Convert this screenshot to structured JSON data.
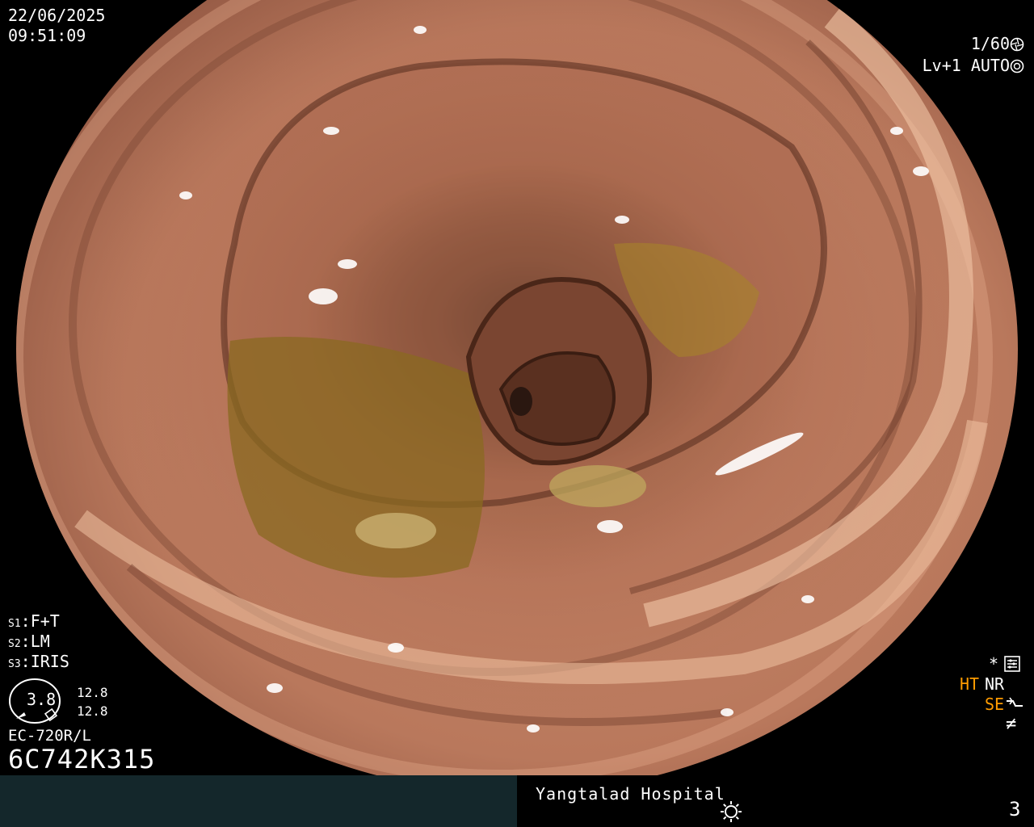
{
  "overlay": {
    "date": "22/06/2025",
    "time": "09:51:09",
    "shutter": "1/60",
    "level": "Lv+1 AUTO",
    "settings": {
      "s1": {
        "key": "S1",
        "value": ":F+T"
      },
      "s2": {
        "key": "S2",
        "value": ":LM"
      },
      "s3": {
        "key": "S3",
        "value": ":IRIS"
      }
    },
    "gauge_value": "3.8",
    "gauge_side_1": "12.8",
    "gauge_side_2": "12.8",
    "model": "EC-720R/L",
    "serial": "6C742K315",
    "indicators": {
      "ht": "HT",
      "nr": "NR",
      "se": "SE"
    },
    "icons": [
      "shutter-icon",
      "aperture-icon",
      "star-icon",
      "menu-icon",
      "se-arrow-icon",
      "notequal-icon",
      "sun-icon"
    ]
  },
  "footer": {
    "hospital": "Yangtalad Hospital",
    "page_number": "3"
  },
  "colors": {
    "highlight": "#ff9b00",
    "footer_left_bg": "#14272b",
    "mucosa": "#c98a6a"
  }
}
